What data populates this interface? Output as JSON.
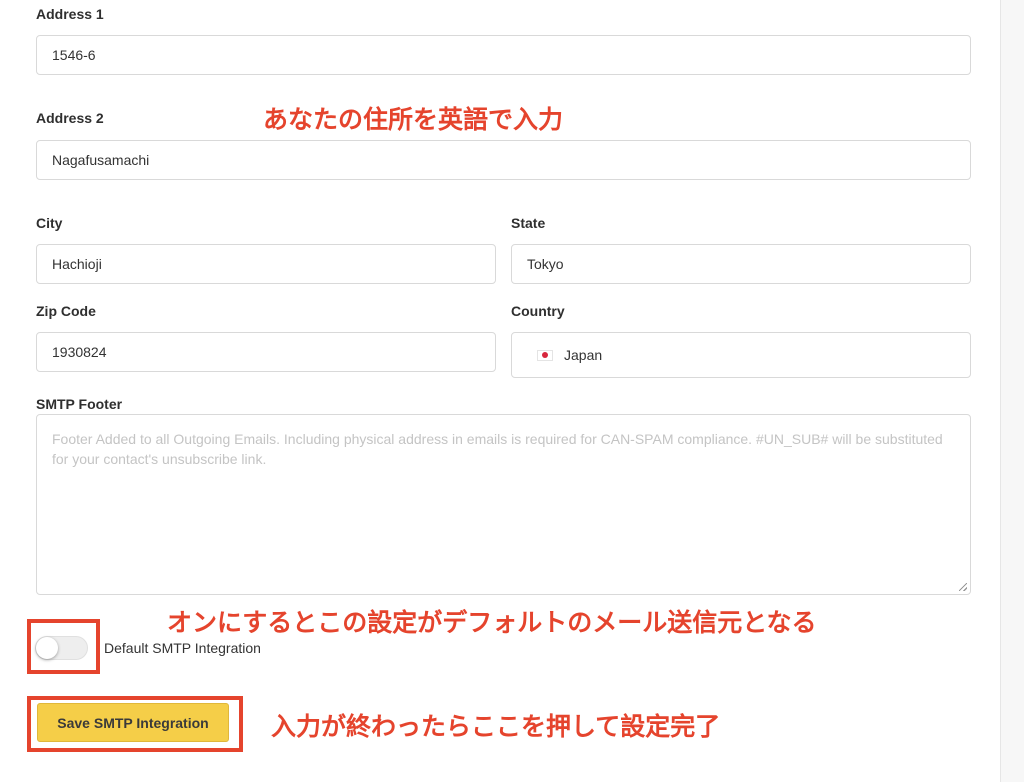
{
  "form": {
    "address1": {
      "label": "Address 1",
      "value": "1546-6"
    },
    "address2": {
      "label": "Address 2",
      "value": "Nagafusamachi"
    },
    "city": {
      "label": "City",
      "value": "Hachioji"
    },
    "state": {
      "label": "State",
      "value": "Tokyo"
    },
    "zip": {
      "label": "Zip Code",
      "value": "1930824"
    },
    "country": {
      "label": "Country",
      "value": "Japan",
      "flag_icon": "japan-flag-icon"
    },
    "smtp_footer": {
      "label": "SMTP Footer",
      "placeholder": "Footer Added to all Outgoing Emails. Including physical address in emails is required for CAN-SPAM compliance. #UN_SUB# will be substituted for your contact's unsubscribe link."
    },
    "default_toggle": {
      "label": "Default SMTP Integration",
      "checked": false
    },
    "save_button": {
      "label": "Save SMTP Integration",
      "color": "#f5ce48"
    }
  },
  "annotations": {
    "address_note": "あなたの住所を英語で入力",
    "toggle_note": "オンにするとこの設定がデフォルトのメール送信元となる",
    "save_note": "入力が終わったらここを押して設定完了",
    "color": "#e5442d"
  }
}
